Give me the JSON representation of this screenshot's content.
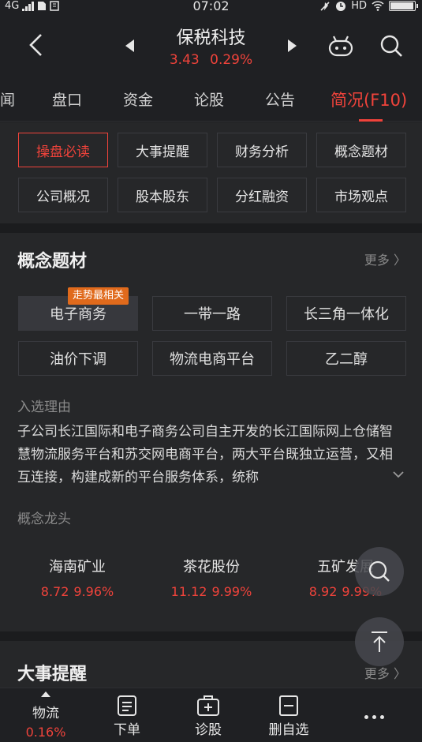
{
  "status_bar": {
    "network": "4G",
    "time": "07:02",
    "hd": "HD"
  },
  "header": {
    "stock_name": "保税科技",
    "price": "3.43",
    "change_pct": "0.29%"
  },
  "tabs": [
    {
      "label": "闻"
    },
    {
      "label": "盘口"
    },
    {
      "label": "资金"
    },
    {
      "label": "论股"
    },
    {
      "label": "公告"
    },
    {
      "label": "简况(F10)"
    }
  ],
  "subnav": [
    {
      "label": "操盘必读"
    },
    {
      "label": "大事提醒"
    },
    {
      "label": "财务分析"
    },
    {
      "label": "概念题材"
    },
    {
      "label": "公司概况"
    },
    {
      "label": "股本股东"
    },
    {
      "label": "分红融资"
    },
    {
      "label": "市场观点"
    }
  ],
  "concept": {
    "title": "概念题材",
    "more": "更多",
    "hot_badge": "走势最相关",
    "chips": [
      {
        "label": "电子商务"
      },
      {
        "label": "一带一路"
      },
      {
        "label": "长三角一体化"
      },
      {
        "label": "油价下调"
      },
      {
        "label": "物流电商平台"
      },
      {
        "label": "乙二醇"
      }
    ],
    "reason_label": "入选理由",
    "reason_text": "子公司长江国际和电子商务公司自主开发的长江国际网上仓储智慧物流服务平台和苏交网电商平台，两大平台既独立运营，又相互连接，构建成新的平台服务体系，统称",
    "leaders_label": "概念龙头",
    "leaders": [
      {
        "name": "海南矿业",
        "price": "8.72",
        "pct": "9.96%"
      },
      {
        "name": "茶花股份",
        "price": "11.12",
        "pct": "9.99%"
      },
      {
        "name": "五矿发展",
        "price": "8.92",
        "pct": "9.99%"
      }
    ]
  },
  "events": {
    "title": "大事提醒",
    "more": "更多"
  },
  "bottom_bar": {
    "sector_name": "物流",
    "sector_pct": "0.16%",
    "items": [
      {
        "label": "下单"
      },
      {
        "label": "诊股"
      },
      {
        "label": "删自选"
      }
    ]
  },
  "colors": {
    "accent_red": "#f0433b",
    "badge_orange": "#e06a1c",
    "background": "#1f2023"
  }
}
